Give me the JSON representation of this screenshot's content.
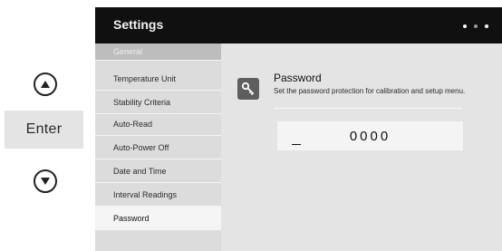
{
  "controls": {
    "up_icon": "triangle-up-icon",
    "enter_label": "Enter",
    "down_icon": "triangle-down-icon"
  },
  "screen": {
    "title": "Settings",
    "page_indicator": {
      "count": 3,
      "active_index": 1
    }
  },
  "sidebar": {
    "items": [
      {
        "label": "General"
      },
      {
        "label": "Temperature Unit"
      },
      {
        "label": "Stability Criteria"
      },
      {
        "label": "Auto-Read"
      },
      {
        "label": "Auto-Power Off"
      },
      {
        "label": "Date and Time"
      },
      {
        "label": "Interval Readings"
      },
      {
        "label": "Password"
      }
    ],
    "selected": "Password"
  },
  "password": {
    "icon": "key-icon",
    "title": "Password",
    "description": "Set the password protection for calibration and setup menu.",
    "value": "0000"
  },
  "colors": {
    "titlebar": "#101010",
    "sidebar": "#dcdcdc",
    "active_item": "#f5f5f5",
    "content": "#e4e4e4"
  }
}
